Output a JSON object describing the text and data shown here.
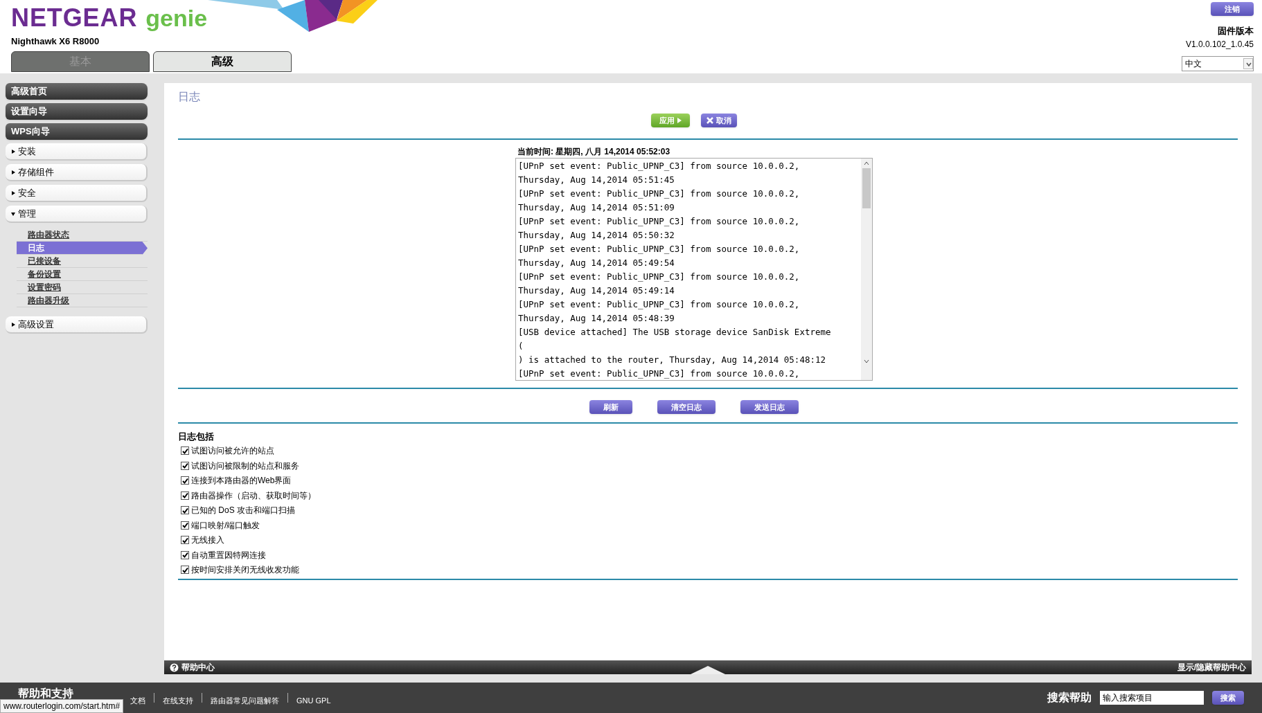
{
  "header": {
    "brand": "NETGEAR",
    "product": "genie",
    "model": "Nighthawk X6 R8000",
    "logout": "注销",
    "firmware_label": "固件版本",
    "firmware_version": "V1.0.0.102_1.0.45",
    "language": "中文"
  },
  "tabs": [
    {
      "label": "基本",
      "selected": false
    },
    {
      "label": "高级",
      "selected": true
    }
  ],
  "sidebar": {
    "items": [
      {
        "kind": "link",
        "label": "高级首页"
      },
      {
        "kind": "link",
        "label": "设置向导"
      },
      {
        "kind": "link",
        "label": "WPS向导"
      },
      {
        "kind": "section",
        "label": "安装",
        "expanded": false
      },
      {
        "kind": "section",
        "label": "存储组件",
        "expanded": false
      },
      {
        "kind": "section",
        "label": "安全",
        "expanded": false
      },
      {
        "kind": "section",
        "label": "管理",
        "expanded": true,
        "children": [
          {
            "label": "路由器状态",
            "selected": false
          },
          {
            "label": "日志",
            "selected": true
          },
          {
            "label": "已接设备",
            "selected": false
          },
          {
            "label": "备份设置",
            "selected": false
          },
          {
            "label": "设置密码",
            "selected": false
          },
          {
            "label": "路由器升级",
            "selected": false
          }
        ]
      },
      {
        "kind": "section",
        "label": "高级设置",
        "expanded": false
      }
    ]
  },
  "page": {
    "title": "日志",
    "apply": "应用",
    "cancel": "取消",
    "current_time": "当前时间: 星期四, 八月 14,2014 05:52:03",
    "log_lines": [
      "[UPnP set event: Public_UPNP_C3] from source 10.0.0.2,",
      "Thursday, Aug 14,2014 05:51:45",
      "[UPnP set event: Public_UPNP_C3] from source 10.0.0.2,",
      "Thursday, Aug 14,2014 05:51:09",
      "[UPnP set event: Public_UPNP_C3] from source 10.0.0.2,",
      "Thursday, Aug 14,2014 05:50:32",
      "[UPnP set event: Public_UPNP_C3] from source 10.0.0.2,",
      "Thursday, Aug 14,2014 05:49:54",
      "[UPnP set event: Public_UPNP_C3] from source 10.0.0.2,",
      "Thursday, Aug 14,2014 05:49:14",
      "[UPnP set event: Public_UPNP_C3] from source 10.0.0.2,",
      "Thursday, Aug 14,2014 05:48:39",
      "[USB device attached] The USB storage device SanDisk Extreme",
      "(",
      ") is attached to the router, Thursday, Aug 14,2014 05:48:12",
      "[UPnP set event: Public_UPNP_C3] from source 10.0.0.2,"
    ],
    "actions": [
      "刷新",
      "清空日志",
      "发送日志"
    ],
    "include_title": "日志包括",
    "options": [
      {
        "label": "试图访问被允许的站点",
        "checked": true
      },
      {
        "label": "试图访问被限制的站点和服务",
        "checked": true
      },
      {
        "label": "连接到本路由器的Web界面",
        "checked": true
      },
      {
        "label": "路由器操作（启动、获取时间等）",
        "checked": true
      },
      {
        "label": "已知的 DoS 攻击和端口扫描",
        "checked": true
      },
      {
        "label": "端口映射/端口触发",
        "checked": true
      },
      {
        "label": "无线接入",
        "checked": true
      },
      {
        "label": "自动重置因特网连接",
        "checked": true
      },
      {
        "label": "按时间安排关闭无线收发功能",
        "checked": true
      }
    ]
  },
  "help_bar": {
    "title": "帮助中心",
    "toggle": "显示/隐藏帮助中心"
  },
  "footer": {
    "title": "帮助和支持",
    "links": [
      "文档",
      "在线支持",
      "路由器常见问题解答",
      "GNU GPL"
    ],
    "search_label": "搜索帮助",
    "search_placeholder": "输入搜索项目",
    "search_button": "搜索"
  },
  "status_url": "www.routerlogin.com/start.htm#"
}
